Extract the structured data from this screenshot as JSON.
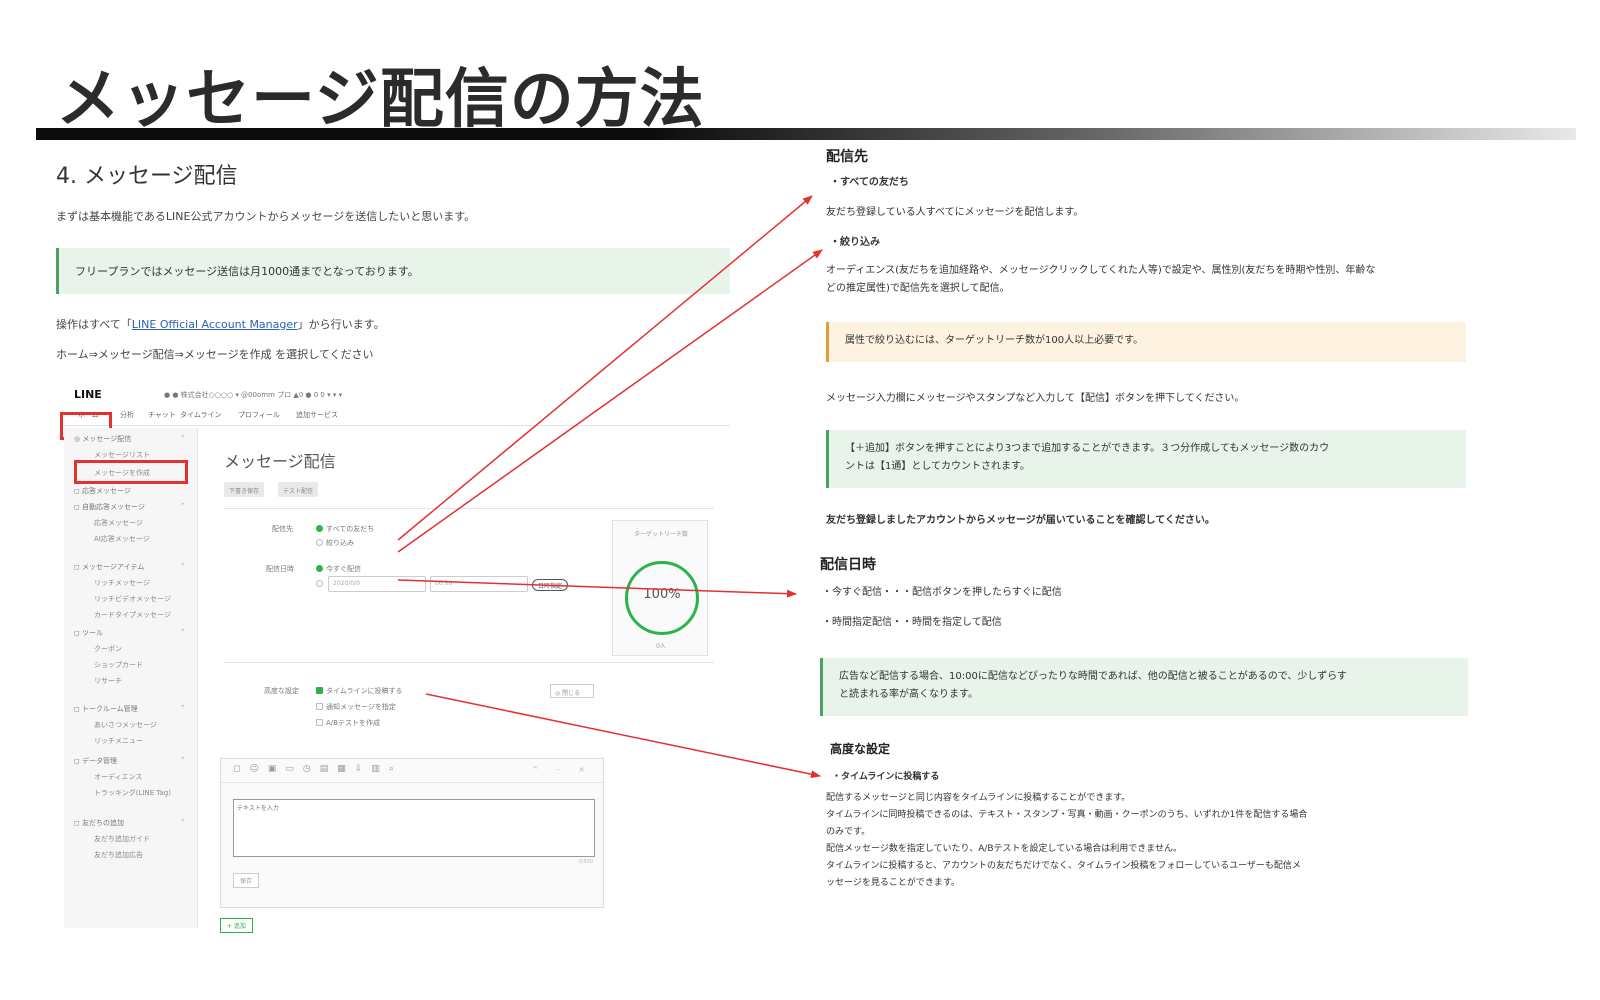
{
  "slide": {
    "title": "メッセージ配信の方法"
  },
  "left": {
    "section_title": "4. メッセージ配信",
    "intro": "まずは基本機能であるLINE公式アカウントからメッセージを送信したいと思います。",
    "note": "フリープランではメッセージ送信は月1000通までとなっております。",
    "operation_prefix": "操作はすべて「",
    "operation_link": "LINE Official Account Manager",
    "operation_suffix": "」から行います。",
    "path": "ホーム⇒メッセージ配信⇒メッセージを作成 を選択してください"
  },
  "screenshot": {
    "logo": "LINE",
    "account_line": "● ● 株式会社○○○○ ▾   @00omm   プロ   ▲0   ● 0 0 ▾ ▾ ▾",
    "nav": [
      "ホーム",
      "分析",
      "チャット",
      "タイムライン",
      "プロフィール",
      "追加サービス"
    ],
    "sidebar": {
      "groups": [
        {
          "label": "◎ メッセージ配信",
          "items": [
            "メッセージリスト",
            "メッセージを作成"
          ]
        },
        {
          "label": "◻ 応答メッセージ",
          "items": []
        },
        {
          "label": "◻ 自動応答メッセージ",
          "items": [
            "応答メッセージ",
            "AI応答メッセージ"
          ]
        },
        {
          "label": "◻ メッセージアイテム",
          "items": [
            "リッチメッセージ",
            "リッチビデオメッセージ",
            "カードタイプメッセージ"
          ]
        },
        {
          "label": "◻ ツール",
          "items": [
            "クーポン",
            "ショップカード",
            "リサーチ"
          ]
        },
        {
          "label": "◻ トークルーム管理",
          "items": [
            "あいさつメッセージ",
            "リッチメニュー"
          ]
        },
        {
          "label": "◻ データ管理",
          "items": [
            "オーディエンス",
            "トラッキング(LINE Tag)"
          ]
        },
        {
          "label": "◻ 友だちの追加",
          "items": [
            "友だち追加ガイド",
            "友だち追加広告"
          ]
        }
      ]
    },
    "main": {
      "title": "メッセージ配信",
      "tabs": [
        "下書き保存",
        "テスト配信"
      ],
      "field_recipients": "配信先",
      "opt_all_friends": "すべての友だち",
      "opt_filter": "絞り込み",
      "field_datetime": "配信日時",
      "opt_now": "今すぐ配信",
      "date_placeholder": "2020/0/0",
      "time_placeholder": "00:00",
      "pill_label": "日時指定",
      "target_card_title": "ターゲットリーチ数",
      "target_percent": "100%",
      "target_foot": "0人",
      "field_advanced": "高度な設定",
      "opt_timeline": "タイムラインに投稿する",
      "opt_push": "通知メッセージを指定",
      "opt_abtest": "A/Bテストを作成",
      "side_btn": "◎ 閉じる",
      "editor_tools": [
        "◻",
        "☺",
        "▣",
        "▭",
        "◷",
        "▤",
        "▦",
        "⇩",
        "▥",
        "⌕"
      ],
      "editor_ctrl": "^ ‐ ×",
      "textarea_placeholder": "テキストを入力",
      "counter": "0/500",
      "save_btn": "保存",
      "add_btn": "+ 追加"
    }
  },
  "right": {
    "recipients_title": "配信先",
    "all_friends_head": "・すべての友だち",
    "all_friends_desc": "友だち登録している人すべてにメッセージを配信します。",
    "filter_head": "・絞り込み",
    "filter_desc_1": "オーディエンス(友だちを追加経路や、メッセージクリックしてくれた人等)で設定や、属性別(友だちを時期や性別、年齢な",
    "filter_desc_2": "どの推定属性)で配信先を選択して配信。",
    "filter_note": "属性で絞り込むには、ターゲットリーチ数が100人以上必要です。",
    "input_desc": "メッセージ入力欄にメッセージやスタンプなど入力して【配信】ボタンを押下してください。",
    "add_note_1": "【＋追加】ボタンを押すことにより3つまで追加することができます。３つ分作成してもメッセージ数のカウ",
    "add_note_2": "ントは【1通】としてカウントされます。",
    "confirm": "友だち登録しましたアカウントからメッセージが届いていることを確認してください。",
    "datetime_title": "配信日時",
    "now_line": "・今すぐ配信・・・配信ボタンを押したらすぐに配信",
    "scheduled_line": "・時間指定配信・・時間を指定して配信",
    "time_note_1": "広告など配信する場合、10:00に配信などぴったりな時間であれば、他の配信と被ることがあるので、少しずらす",
    "time_note_2": "と読まれる率が高くなります。",
    "advanced_title": "高度な設定",
    "timeline_head": "・タイムラインに投稿する",
    "advanced_lines": [
      "配信するメッセージと同じ内容をタイムラインに投稿することができます。",
      "タイムラインに同時投稿できるのは、テキスト・スタンプ・写真・動画・クーポンのうち、いずれか1件を配信する場合",
      "のみです。",
      "配信メッセージ数を指定していたり、A/Bテストを設定している場合は利用できません。",
      "タイムラインに投稿すると、アカウントの友だちだけでなく、タイムライン投稿をフォローしているユーザーも配信メ",
      "ッセージを見ることができます。"
    ]
  },
  "colors": {
    "arrow": "#e53030",
    "highlight_box": "#e53030",
    "line_green": "#2db34a"
  }
}
